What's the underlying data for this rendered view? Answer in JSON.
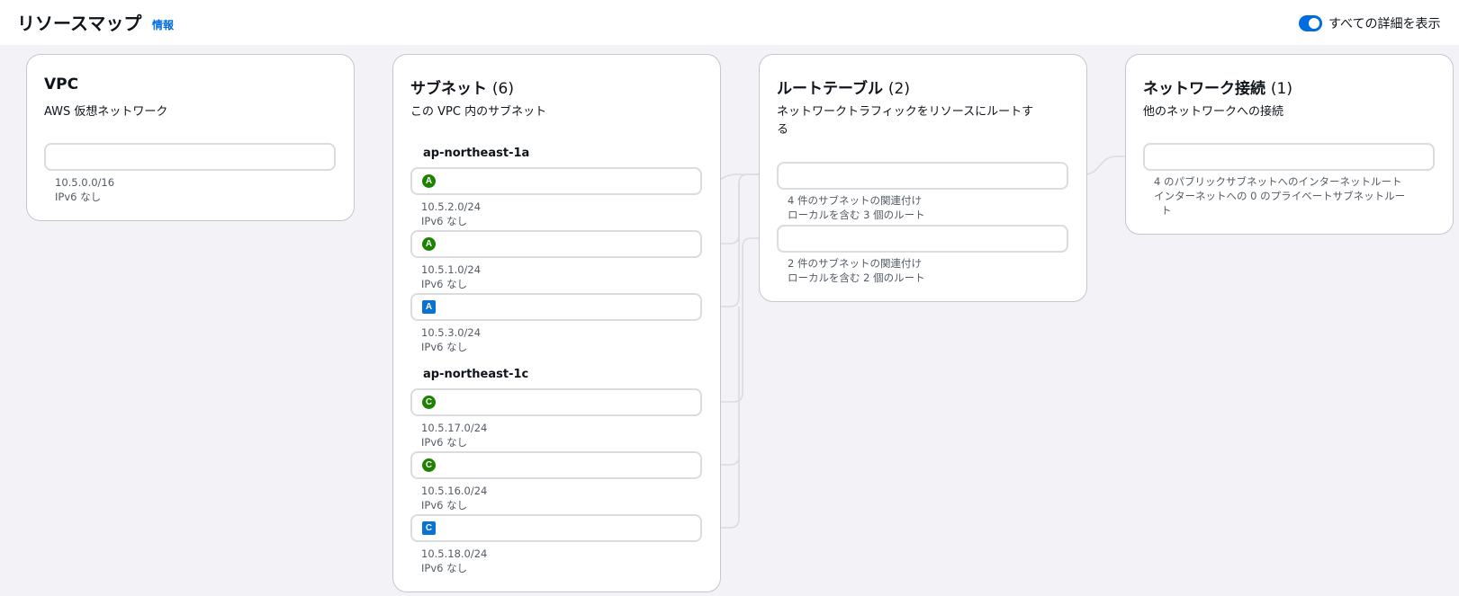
{
  "header": {
    "title": "リソースマップ",
    "info_link": "情報",
    "toggle_label": "すべての詳細を表示",
    "toggle_on": true
  },
  "vpc_card": {
    "title": "VPC",
    "description": "AWS 仮想ネットワーク",
    "cidr": "10.5.0.0/16",
    "ipv6": "IPv6 なし"
  },
  "subnets_card": {
    "title": "サブネット",
    "count": "(6)",
    "description": "この VPC 内のサブネット",
    "zones": [
      {
        "name": "ap-northeast-1a",
        "subnets": [
          {
            "badge": "A",
            "type": "public",
            "cidr": "10.5.2.0/24",
            "ipv6": "IPv6 なし"
          },
          {
            "badge": "A",
            "type": "public",
            "cidr": "10.5.1.0/24",
            "ipv6": "IPv6 なし"
          },
          {
            "badge": "A",
            "type": "private",
            "cidr": "10.5.3.0/24",
            "ipv6": "IPv6 なし"
          }
        ]
      },
      {
        "name": "ap-northeast-1c",
        "subnets": [
          {
            "badge": "C",
            "type": "public",
            "cidr": "10.5.17.0/24",
            "ipv6": "IPv6 なし"
          },
          {
            "badge": "C",
            "type": "public",
            "cidr": "10.5.16.0/24",
            "ipv6": "IPv6 なし"
          },
          {
            "badge": "C",
            "type": "private",
            "cidr": "10.5.18.0/24",
            "ipv6": "IPv6 なし"
          }
        ]
      }
    ]
  },
  "route_tables_card": {
    "title": "ルートテーブル",
    "count": "(2)",
    "description_line1": "ネットワークトラフィックをリソースにルートす",
    "description_line2": "る",
    "tables": [
      {
        "associations": "4 件のサブネットの関連付け",
        "routes": "ローカルを含む 3 個のルート"
      },
      {
        "associations": "2 件のサブネットの関連付け",
        "routes": "ローカルを含む 2 個のルート"
      }
    ]
  },
  "network_card": {
    "title": "ネットワーク接続",
    "count": "(1)",
    "description": "他のネットワークへの接続",
    "connection": {
      "line1": "4 のパブリックサブネットへのインターネットルート",
      "line2": "インターネットへの 0 のプライベートサブネットルー",
      "line3": "ト"
    }
  },
  "colors": {
    "accent": "#006ce0",
    "public_badge": "#1d8102",
    "private_badge": "#0972d3",
    "connector": "#dbdbe0"
  }
}
